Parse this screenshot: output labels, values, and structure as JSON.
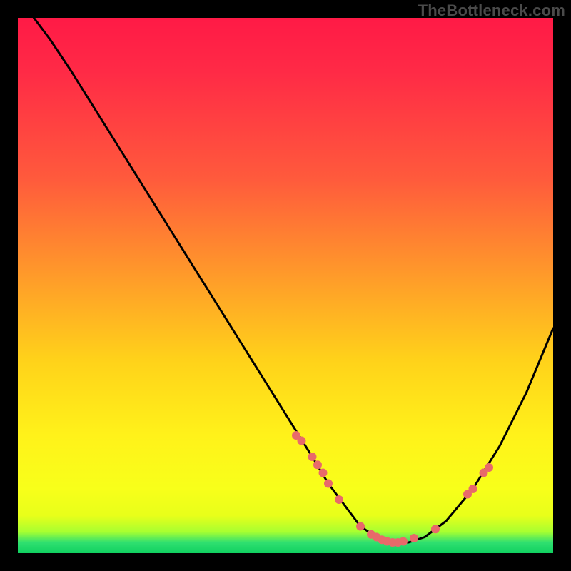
{
  "watermark": "TheBottleneck.com",
  "chart_data": {
    "type": "line",
    "title": "",
    "xlabel": "",
    "ylabel": "",
    "xlim": [
      0,
      100
    ],
    "ylim": [
      0,
      100
    ],
    "curve": {
      "name": "bottleneck-curve",
      "x": [
        3,
        6,
        10,
        15,
        20,
        25,
        30,
        35,
        40,
        45,
        50,
        55,
        58,
        61,
        64,
        67,
        70,
        73,
        76,
        80,
        85,
        90,
        95,
        100
      ],
      "y": [
        100,
        96,
        90,
        82,
        74,
        66,
        58,
        50,
        42,
        34,
        26,
        18,
        13,
        9,
        5,
        3,
        2,
        2,
        3,
        6,
        12,
        20,
        30,
        42
      ]
    },
    "markers": {
      "name": "highlight-dots",
      "x": [
        52,
        53,
        55,
        56,
        57,
        58,
        60,
        64,
        66,
        67,
        68,
        69,
        70,
        71,
        72,
        74,
        78,
        84,
        85,
        87,
        88
      ],
      "y": [
        22,
        21,
        18,
        16.5,
        15,
        13,
        10,
        5,
        3.5,
        3,
        2.5,
        2.2,
        2,
        2,
        2.2,
        2.8,
        4.5,
        11,
        12,
        15,
        16
      ],
      "color": "#e86a6a",
      "radius": 6
    },
    "gradient_stops": [
      {
        "pos": 0,
        "color": "#ff1a46"
      },
      {
        "pos": 30,
        "color": "#ff5a3c"
      },
      {
        "pos": 64,
        "color": "#ffd21a"
      },
      {
        "pos": 93,
        "color": "#e8ff1a"
      },
      {
        "pos": 100,
        "color": "#10d060"
      }
    ]
  }
}
